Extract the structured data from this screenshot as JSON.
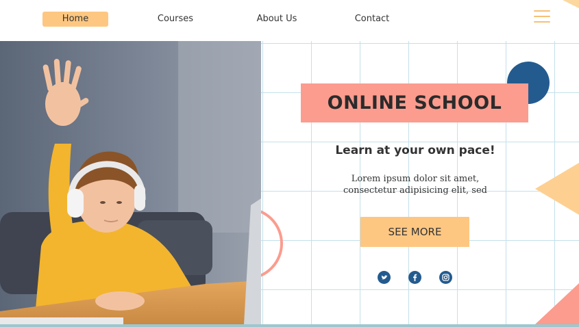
{
  "nav": {
    "items": [
      {
        "label": "Home",
        "active": true
      },
      {
        "label": "Courses",
        "active": false
      },
      {
        "label": "About Us",
        "active": false
      },
      {
        "label": "Contact",
        "active": false
      }
    ],
    "menu_icon": "hamburger-icon"
  },
  "hero": {
    "title": "ONLINE SCHOOL",
    "subtitle": "Learn at your own pace!",
    "body_line1": "Lorem ipsum dolor sit amet,",
    "body_line2": "consectetur adipisicing elit, sed",
    "cta_label": "SEE MORE"
  },
  "social": [
    {
      "name": "twitter",
      "icon": "twitter-icon"
    },
    {
      "name": "facebook",
      "icon": "facebook-icon"
    },
    {
      "name": "instagram",
      "icon": "instagram-icon"
    }
  ],
  "colors": {
    "accent_peach": "#fdc782",
    "accent_pink": "#fb9c8e",
    "accent_blue": "#245b8f",
    "grid_line": "#c3e0ea"
  }
}
